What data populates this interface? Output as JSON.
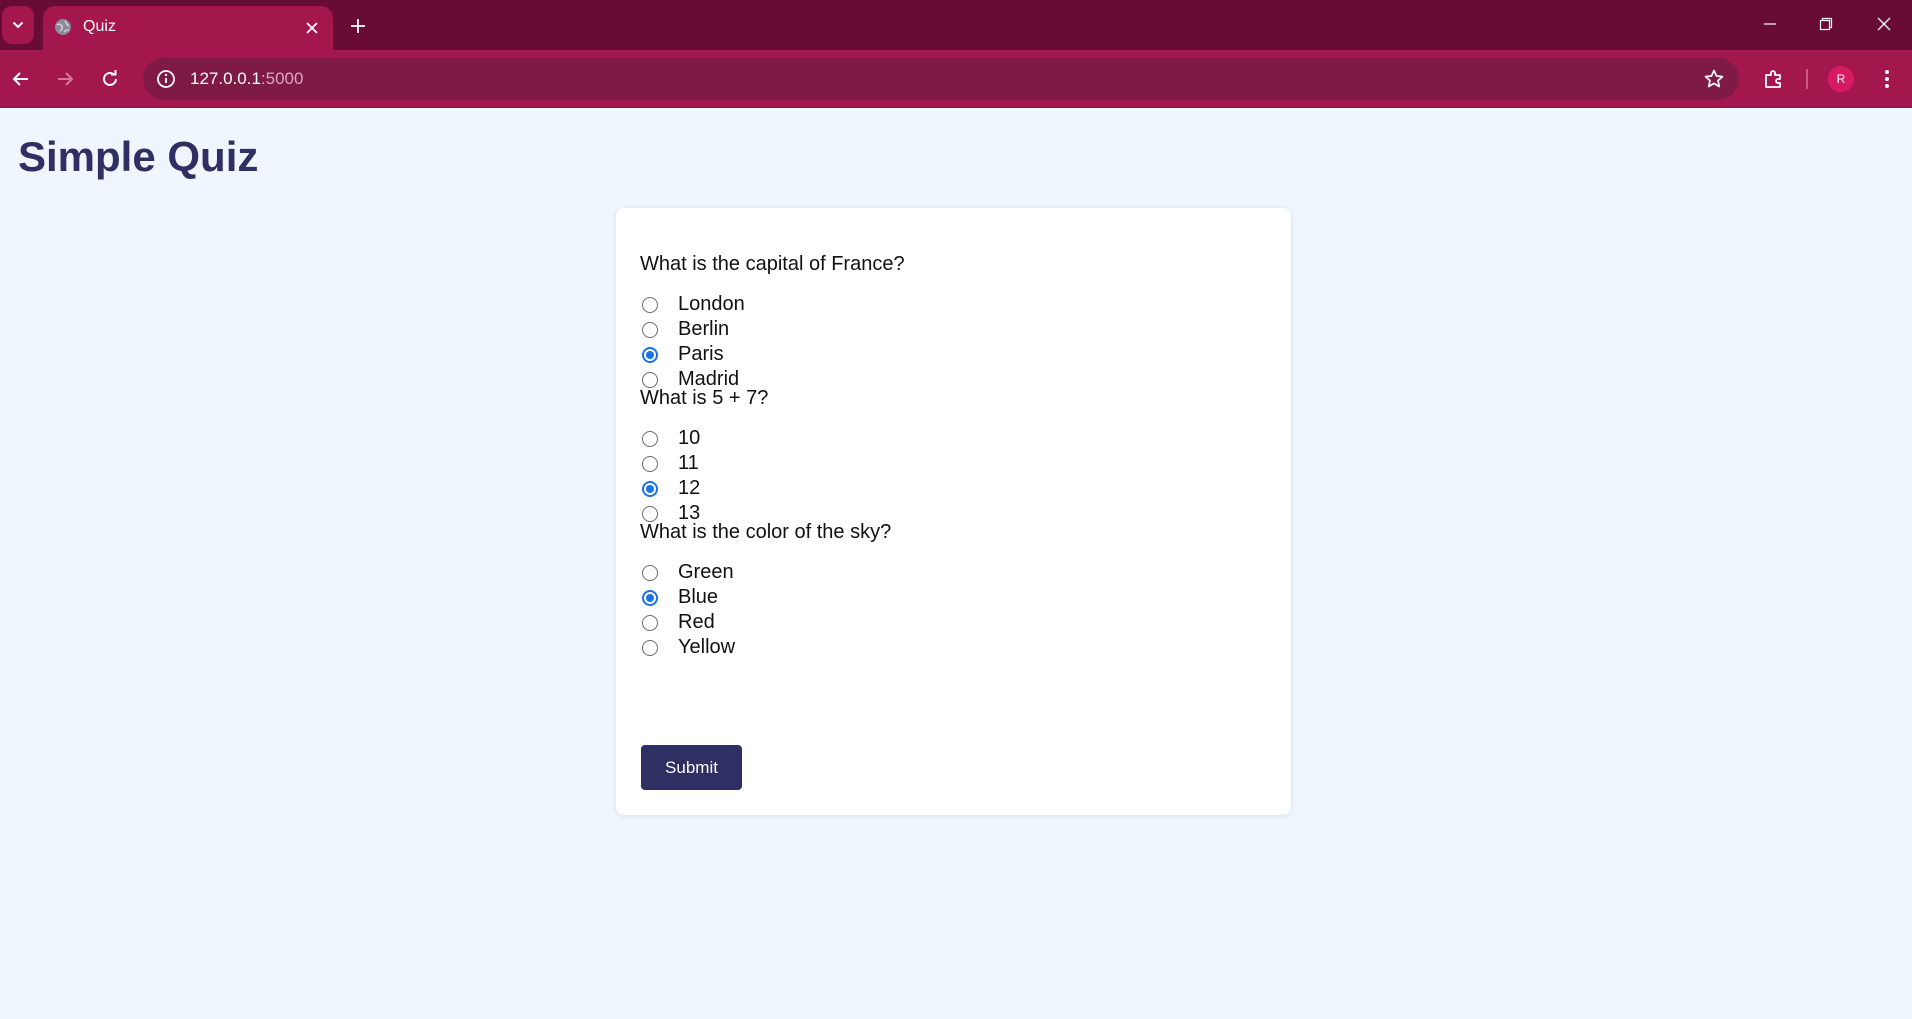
{
  "browser": {
    "tab_title": "Quiz",
    "url_host": "127.0.0.1",
    "url_port": ":5000",
    "profile_initial": "R",
    "colors": {
      "frame": "#680c35",
      "toolbar": "#a3174c",
      "omnibox": "#7f1a44"
    },
    "icons": [
      "tab-list-icon",
      "globe-icon",
      "close-icon",
      "plus-icon",
      "minimize-icon",
      "restore-icon",
      "window-close-icon",
      "back-icon",
      "forward-icon",
      "reload-icon",
      "info-icon",
      "star-icon",
      "extensions-icon",
      "menu-icon"
    ]
  },
  "page": {
    "title": "Simple Quiz",
    "colors": {
      "background": "#eff6fd",
      "accent": "#2e2f63",
      "radio_checked": "#1a73e8"
    },
    "questions": [
      {
        "text": "What is the capital of France?",
        "options": [
          "London",
          "Berlin",
          "Paris",
          "Madrid"
        ],
        "selected": "Paris"
      },
      {
        "text": "What is 5 + 7?",
        "options": [
          "10",
          "11",
          "12",
          "13"
        ],
        "selected": "12"
      },
      {
        "text": "What is the color of the sky?",
        "options": [
          "Green",
          "Blue",
          "Red",
          "Yellow"
        ],
        "selected": "Blue"
      }
    ],
    "submit_label": "Submit"
  }
}
